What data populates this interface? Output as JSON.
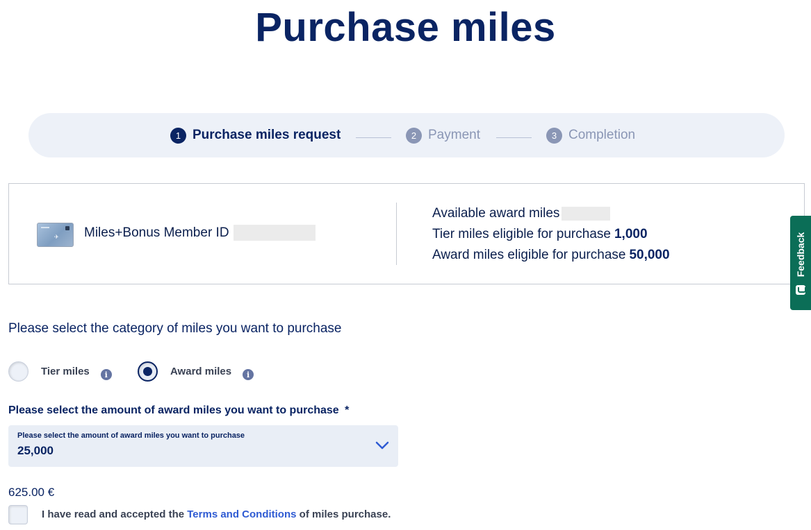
{
  "page": {
    "title": "Purchase miles"
  },
  "stepper": {
    "steps": [
      {
        "number": "1",
        "label": "Purchase miles request",
        "state": "active"
      },
      {
        "number": "2",
        "label": "Payment",
        "state": "inactive"
      },
      {
        "number": "3",
        "label": "Completion",
        "state": "inactive"
      }
    ]
  },
  "member": {
    "id_label": "Miles+Bonus Member ID",
    "available_label": "Available award miles",
    "tier_eligible_label": "Tier miles eligible for purchase",
    "tier_eligible_value": "1,000",
    "award_eligible_label": "Award miles eligible for purchase",
    "award_eligible_value": "50,000"
  },
  "category": {
    "question": "Please select the category of miles you want to purchase",
    "options": [
      {
        "label": "Tier miles",
        "selected": false
      },
      {
        "label": "Award miles",
        "selected": true
      }
    ]
  },
  "amount": {
    "question": "Please select the amount of award miles you want to purchase",
    "required_marker": "*",
    "select_label": "Please select the amount of award miles you want to purchase",
    "select_value": "25,000"
  },
  "price": "625.00 €",
  "terms": {
    "prefix": "I have read and accepted the",
    "link": "Terms and Conditions",
    "suffix": "of miles purchase."
  },
  "feedback": {
    "label": "Feedback"
  },
  "colors": {
    "brand_navy": "#0a2463",
    "link_blue": "#2f5bd3",
    "stepper_bg": "#edf1f8",
    "feedback_green": "#0b6e57"
  },
  "icons": {
    "info": "info-icon",
    "chevron": "chevron-down-icon",
    "feedback": "feedback-icon"
  }
}
